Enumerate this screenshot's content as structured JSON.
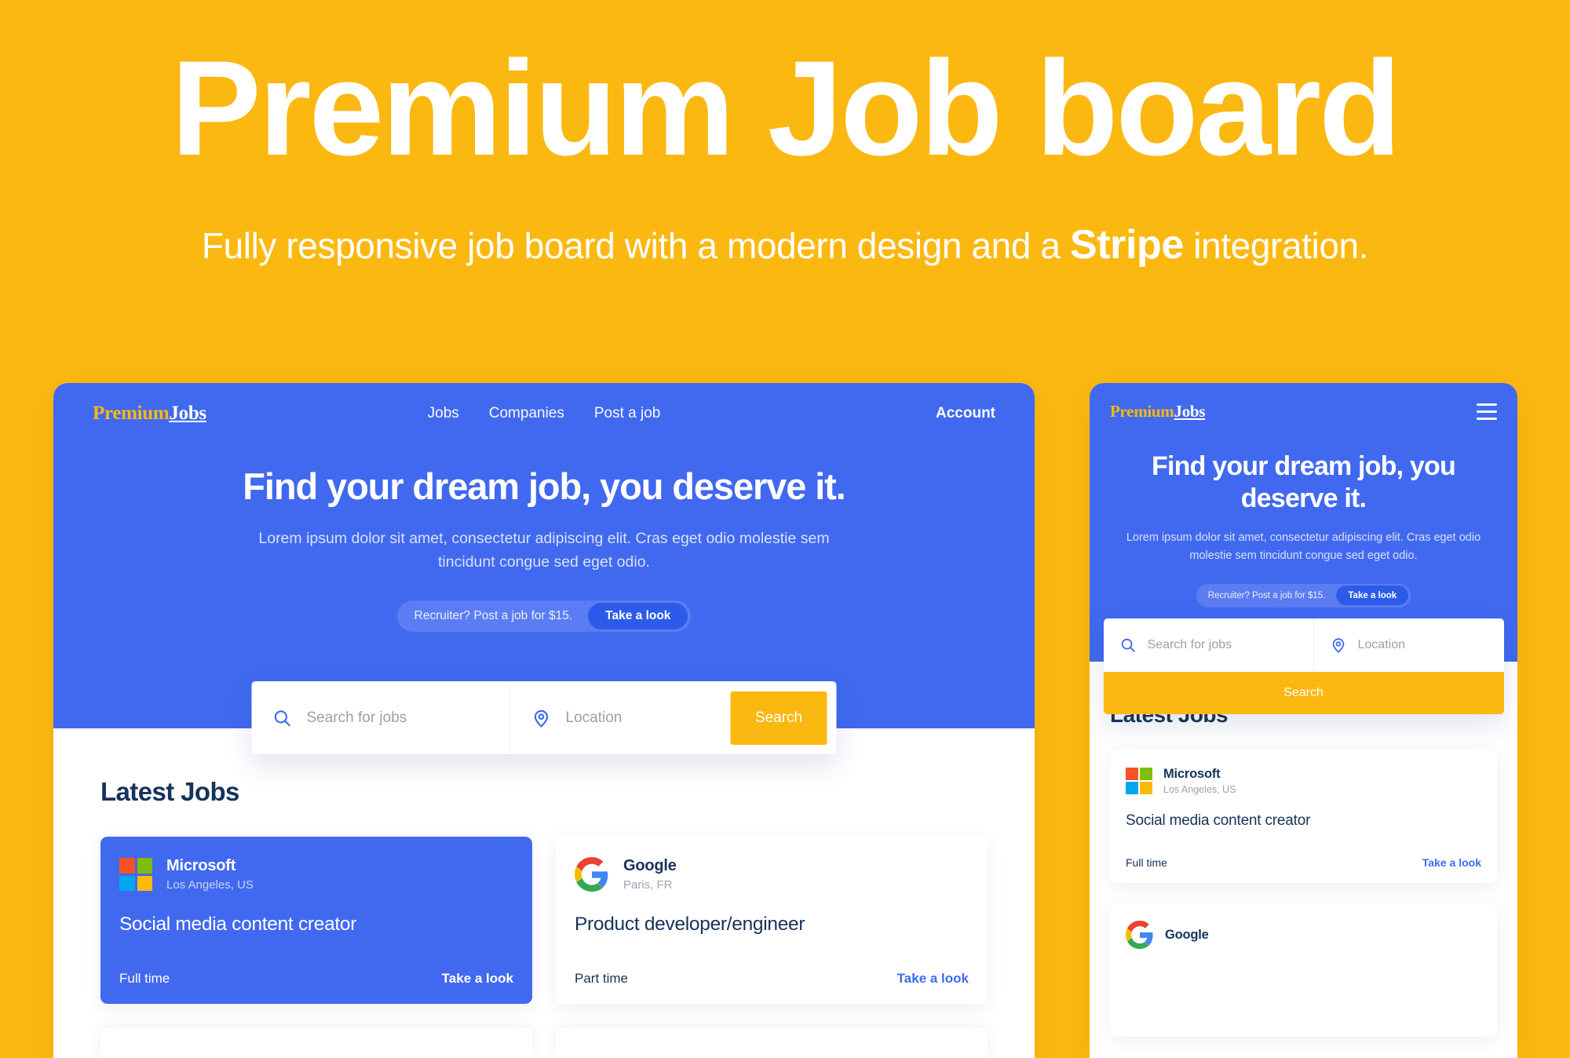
{
  "banner": {
    "title": "Premium Job board",
    "subtitle_before": "Fully responsive job board with a modern design and a ",
    "subtitle_strong": "Stripe",
    "subtitle_after": " integration."
  },
  "colors": {
    "page_background": "#FBB811",
    "brand_blue": "#4169EF",
    "accent_yellow": "#FBB811",
    "pill_blue": "#5B7CF2",
    "pill_button_blue": "#2B5BE8",
    "heading_navy": "#16335A",
    "link_blue": "#3D6BEE"
  },
  "desktop": {
    "logo": {
      "part1": "Premium",
      "part2": "Jobs"
    },
    "nav": {
      "links": [
        {
          "label": "Jobs"
        },
        {
          "label": "Companies"
        },
        {
          "label": "Post a job"
        }
      ],
      "account_label": "Account"
    },
    "hero": {
      "title": "Find your dream job, you deserve it.",
      "subtitle": "Lorem ipsum dolor sit amet, consectetur adipiscing elit. Cras eget odio molestie sem tincidunt congue sed eget odio.",
      "pill_text": "Recruiter? Post a job for $15.",
      "pill_button": "Take a look"
    },
    "search": {
      "jobs_placeholder": "Search for jobs",
      "location_placeholder": "Location",
      "button_label": "Search",
      "jobs_icon": "search-icon",
      "location_icon": "map-pin-icon"
    },
    "section_title": "Latest Jobs",
    "jobs": [
      {
        "company": "Microsoft",
        "location": "Los Angeles, US",
        "title": "Social media content creator",
        "type": "Full time",
        "link": "Take a look",
        "logo": "microsoft-logo",
        "style": "blue"
      },
      {
        "company": "Google",
        "location": "Paris, FR",
        "title": "Product developer/engineer",
        "type": "Part time",
        "link": "Take a look",
        "logo": "google-logo",
        "style": "white"
      }
    ]
  },
  "mobile": {
    "logo": {
      "part1": "Premium",
      "part2": "Jobs"
    },
    "menu_icon": "hamburger-menu-icon",
    "hero": {
      "title": "Find your dream job, you deserve it.",
      "subtitle": "Lorem ipsum dolor sit amet, consectetur adipiscing elit. Cras eget odio molestie sem tincidunt congue sed eget odio.",
      "pill_text": "Recruiter? Post a job for $15.",
      "pill_button": "Take a look"
    },
    "search": {
      "jobs_placeholder": "Search for jobs",
      "location_placeholder": "Location",
      "button_label": "Search",
      "jobs_icon": "search-icon",
      "location_icon": "map-pin-icon"
    },
    "section_title": "Latest Jobs",
    "jobs": [
      {
        "company": "Microsoft",
        "location": "Los Angeles, US",
        "title": "Social media content creator",
        "type": "Full time",
        "link": "Take a look",
        "logo": "microsoft-logo"
      },
      {
        "company": "Google",
        "logo": "google-logo"
      }
    ]
  }
}
